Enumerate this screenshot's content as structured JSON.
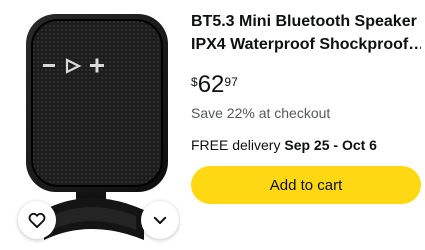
{
  "product": {
    "title_line1": "BT5.3 Mini Bluetooth Speaker",
    "title_line2": "IPX4 Waterproof Shockproof…",
    "price": {
      "symbol": "$",
      "whole": "62",
      "fraction": "97"
    },
    "savings": "Save 22% at checkout",
    "delivery_prefix": "FREE delivery",
    "delivery_dates": "Sep 25 - Oct 6"
  },
  "actions": {
    "add_to_cart": "Add to cart"
  },
  "icons": {
    "favorite": "heart-icon",
    "more": "chevron-down-icon"
  },
  "colors": {
    "cart_button": "#ffd814",
    "secondary_text": "#565959",
    "primary_text": "#0f1111"
  }
}
